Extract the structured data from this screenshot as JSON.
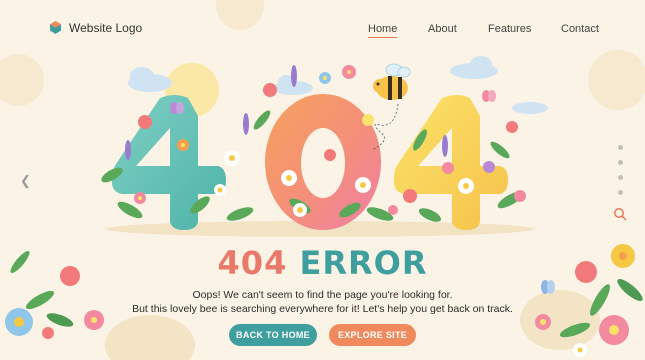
{
  "header": {
    "logo_text": "Website Logo",
    "nav": [
      "Home",
      "About",
      "Features",
      "Contact"
    ],
    "active_nav": "Home"
  },
  "hero": {
    "digits": [
      "4",
      "0",
      "4"
    ],
    "headline_code": "404",
    "headline_word": "ERROR",
    "message_line1": "Oops! We can't seem to find the page you're looking for.",
    "message_line2": "But this lovely bee is searching everywhere for it! Let's help you get back on track.",
    "btn_home": "BACK TO HOME",
    "btn_explore": "EXPLORE SITE"
  },
  "colors": {
    "background": "#fbf4e6",
    "teal": "#3f9e9e",
    "coral": "#e97a6a",
    "orange": "#f08a5d"
  },
  "icons": [
    "logo-icon",
    "chevron-left-icon",
    "search-icon",
    "bee-icon",
    "butterfly-icon",
    "cloud-icon",
    "sun-icon"
  ]
}
